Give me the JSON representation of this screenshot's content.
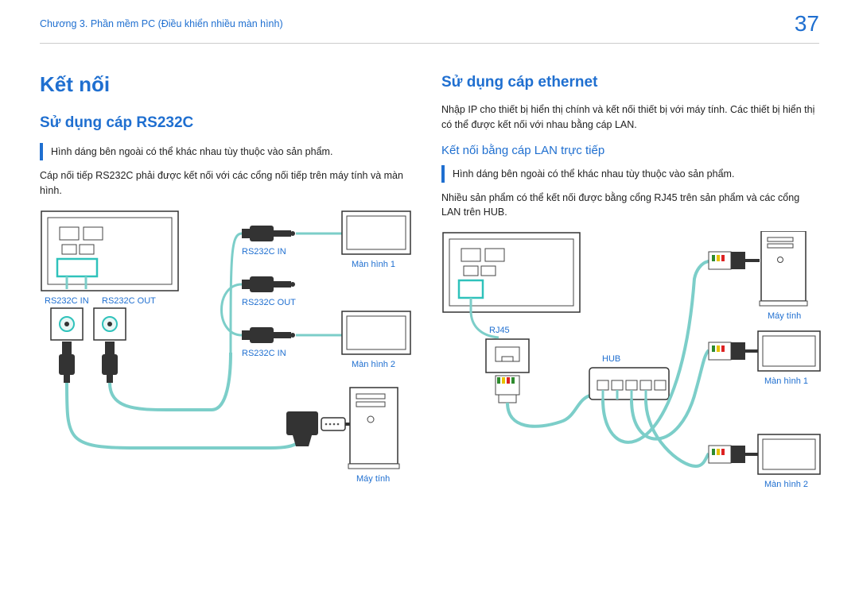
{
  "header": {
    "breadcrumb": "Chương 3. Phần mềm PC (Điều khiển nhiều màn hình)",
    "page_number": "37"
  },
  "left": {
    "h1": "Kết nối",
    "h2": "Sử dụng cáp RS232C",
    "note": "Hình dáng bên ngoài có thể khác nhau tùy thuộc vào sản phẩm.",
    "body": "Cáp nối tiếp RS232C phải được kết nối với các cổng nối tiếp trên máy tính và màn hình.",
    "labels": {
      "rs232c_in_left": "RS232C IN",
      "rs232c_out_left": "RS232C OUT",
      "rs232c_in_mid_top": "RS232C IN",
      "rs232c_out_mid": "RS232C OUT",
      "rs232c_in_mid_bot": "RS232C IN",
      "monitor1": "Màn hình 1",
      "monitor2": "Màn hình 2",
      "computer": "Máy tính"
    }
  },
  "right": {
    "h2": "Sử dụng cáp ethernet",
    "body": "Nhập IP cho thiết bị hiển thị chính và kết nối thiết bị với máy tính. Các thiết bị hiển thị có thể được kết nối với nhau bằng cáp LAN.",
    "h3": "Kết nối bằng cáp LAN trực tiếp",
    "note": "Hình dáng bên ngoài có thể khác nhau tùy thuộc vào sản phẩm.",
    "body2": "Nhiều sản phẩm có thể kết nối được bằng cổng RJ45 trên sản phẩm và các cổng LAN trên HUB.",
    "labels": {
      "rj45": "RJ45",
      "hub": "HUB",
      "computer": "Máy tính",
      "monitor1": "Màn hình 1",
      "monitor2": "Màn hình 2"
    }
  }
}
